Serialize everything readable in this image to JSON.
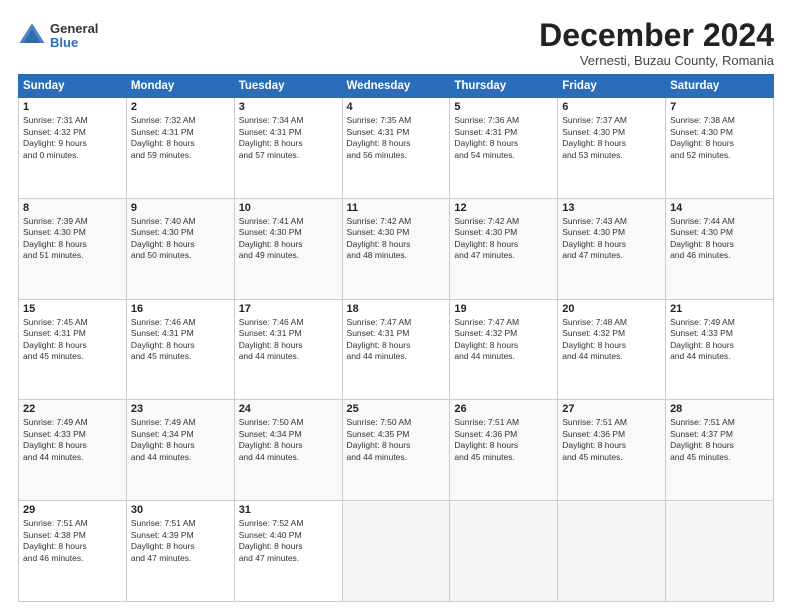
{
  "header": {
    "logo_general": "General",
    "logo_blue": "Blue",
    "month_title": "December 2024",
    "location": "Vernesti, Buzau County, Romania"
  },
  "days_of_week": [
    "Sunday",
    "Monday",
    "Tuesday",
    "Wednesday",
    "Thursday",
    "Friday",
    "Saturday"
  ],
  "weeks": [
    [
      {
        "day": "1",
        "lines": [
          "Sunrise: 7:31 AM",
          "Sunset: 4:32 PM",
          "Daylight: 9 hours",
          "and 0 minutes."
        ]
      },
      {
        "day": "2",
        "lines": [
          "Sunrise: 7:32 AM",
          "Sunset: 4:31 PM",
          "Daylight: 8 hours",
          "and 59 minutes."
        ]
      },
      {
        "day": "3",
        "lines": [
          "Sunrise: 7:34 AM",
          "Sunset: 4:31 PM",
          "Daylight: 8 hours",
          "and 57 minutes."
        ]
      },
      {
        "day": "4",
        "lines": [
          "Sunrise: 7:35 AM",
          "Sunset: 4:31 PM",
          "Daylight: 8 hours",
          "and 56 minutes."
        ]
      },
      {
        "day": "5",
        "lines": [
          "Sunrise: 7:36 AM",
          "Sunset: 4:31 PM",
          "Daylight: 8 hours",
          "and 54 minutes."
        ]
      },
      {
        "day": "6",
        "lines": [
          "Sunrise: 7:37 AM",
          "Sunset: 4:30 PM",
          "Daylight: 8 hours",
          "and 53 minutes."
        ]
      },
      {
        "day": "7",
        "lines": [
          "Sunrise: 7:38 AM",
          "Sunset: 4:30 PM",
          "Daylight: 8 hours",
          "and 52 minutes."
        ]
      }
    ],
    [
      {
        "day": "8",
        "lines": [
          "Sunrise: 7:39 AM",
          "Sunset: 4:30 PM",
          "Daylight: 8 hours",
          "and 51 minutes."
        ]
      },
      {
        "day": "9",
        "lines": [
          "Sunrise: 7:40 AM",
          "Sunset: 4:30 PM",
          "Daylight: 8 hours",
          "and 50 minutes."
        ]
      },
      {
        "day": "10",
        "lines": [
          "Sunrise: 7:41 AM",
          "Sunset: 4:30 PM",
          "Daylight: 8 hours",
          "and 49 minutes."
        ]
      },
      {
        "day": "11",
        "lines": [
          "Sunrise: 7:42 AM",
          "Sunset: 4:30 PM",
          "Daylight: 8 hours",
          "and 48 minutes."
        ]
      },
      {
        "day": "12",
        "lines": [
          "Sunrise: 7:42 AM",
          "Sunset: 4:30 PM",
          "Daylight: 8 hours",
          "and 47 minutes."
        ]
      },
      {
        "day": "13",
        "lines": [
          "Sunrise: 7:43 AM",
          "Sunset: 4:30 PM",
          "Daylight: 8 hours",
          "and 47 minutes."
        ]
      },
      {
        "day": "14",
        "lines": [
          "Sunrise: 7:44 AM",
          "Sunset: 4:30 PM",
          "Daylight: 8 hours",
          "and 46 minutes."
        ]
      }
    ],
    [
      {
        "day": "15",
        "lines": [
          "Sunrise: 7:45 AM",
          "Sunset: 4:31 PM",
          "Daylight: 8 hours",
          "and 45 minutes."
        ]
      },
      {
        "day": "16",
        "lines": [
          "Sunrise: 7:46 AM",
          "Sunset: 4:31 PM",
          "Daylight: 8 hours",
          "and 45 minutes."
        ]
      },
      {
        "day": "17",
        "lines": [
          "Sunrise: 7:46 AM",
          "Sunset: 4:31 PM",
          "Daylight: 8 hours",
          "and 44 minutes."
        ]
      },
      {
        "day": "18",
        "lines": [
          "Sunrise: 7:47 AM",
          "Sunset: 4:31 PM",
          "Daylight: 8 hours",
          "and 44 minutes."
        ]
      },
      {
        "day": "19",
        "lines": [
          "Sunrise: 7:47 AM",
          "Sunset: 4:32 PM",
          "Daylight: 8 hours",
          "and 44 minutes."
        ]
      },
      {
        "day": "20",
        "lines": [
          "Sunrise: 7:48 AM",
          "Sunset: 4:32 PM",
          "Daylight: 8 hours",
          "and 44 minutes."
        ]
      },
      {
        "day": "21",
        "lines": [
          "Sunrise: 7:49 AM",
          "Sunset: 4:33 PM",
          "Daylight: 8 hours",
          "and 44 minutes."
        ]
      }
    ],
    [
      {
        "day": "22",
        "lines": [
          "Sunrise: 7:49 AM",
          "Sunset: 4:33 PM",
          "Daylight: 8 hours",
          "and 44 minutes."
        ]
      },
      {
        "day": "23",
        "lines": [
          "Sunrise: 7:49 AM",
          "Sunset: 4:34 PM",
          "Daylight: 8 hours",
          "and 44 minutes."
        ]
      },
      {
        "day": "24",
        "lines": [
          "Sunrise: 7:50 AM",
          "Sunset: 4:34 PM",
          "Daylight: 8 hours",
          "and 44 minutes."
        ]
      },
      {
        "day": "25",
        "lines": [
          "Sunrise: 7:50 AM",
          "Sunset: 4:35 PM",
          "Daylight: 8 hours",
          "and 44 minutes."
        ]
      },
      {
        "day": "26",
        "lines": [
          "Sunrise: 7:51 AM",
          "Sunset: 4:36 PM",
          "Daylight: 8 hours",
          "and 45 minutes."
        ]
      },
      {
        "day": "27",
        "lines": [
          "Sunrise: 7:51 AM",
          "Sunset: 4:36 PM",
          "Daylight: 8 hours",
          "and 45 minutes."
        ]
      },
      {
        "day": "28",
        "lines": [
          "Sunrise: 7:51 AM",
          "Sunset: 4:37 PM",
          "Daylight: 8 hours",
          "and 45 minutes."
        ]
      }
    ],
    [
      {
        "day": "29",
        "lines": [
          "Sunrise: 7:51 AM",
          "Sunset: 4:38 PM",
          "Daylight: 8 hours",
          "and 46 minutes."
        ]
      },
      {
        "day": "30",
        "lines": [
          "Sunrise: 7:51 AM",
          "Sunset: 4:39 PM",
          "Daylight: 8 hours",
          "and 47 minutes."
        ]
      },
      {
        "day": "31",
        "lines": [
          "Sunrise: 7:52 AM",
          "Sunset: 4:40 PM",
          "Daylight: 8 hours",
          "and 47 minutes."
        ]
      },
      {
        "day": "",
        "lines": []
      },
      {
        "day": "",
        "lines": []
      },
      {
        "day": "",
        "lines": []
      },
      {
        "day": "",
        "lines": []
      }
    ]
  ]
}
